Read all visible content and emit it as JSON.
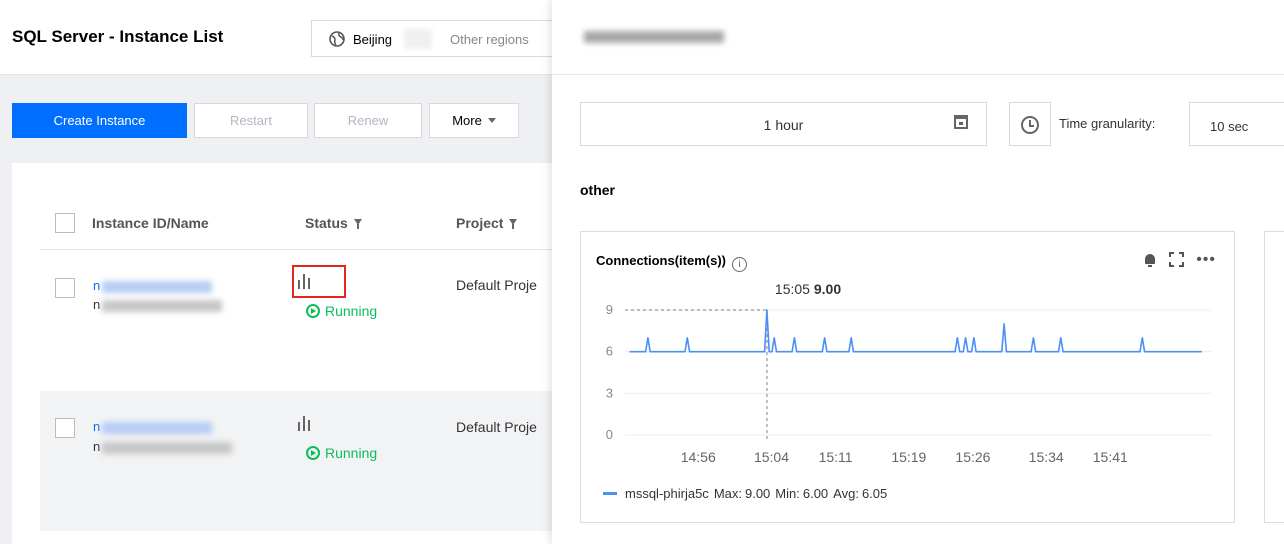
{
  "page": {
    "title": "SQL Server - Instance List",
    "region": {
      "current": "Beijing",
      "other": "Other regions"
    }
  },
  "toolbar": {
    "create_label": "Create Instance",
    "restart_label": "Restart",
    "renew_label": "Renew",
    "more_label": "More"
  },
  "table": {
    "columns": [
      "Instance ID/Name",
      "Status",
      "Project"
    ],
    "rows": [
      {
        "id_prefix": "n",
        "name_prefix": "n",
        "status": "Running",
        "project": "Default Proje"
      },
      {
        "id_prefix": "n",
        "name_prefix": "n",
        "status": "Running",
        "project": "Default Proje"
      }
    ]
  },
  "drawer": {
    "time_range": "1 hour",
    "granularity_label": "Time granularity:",
    "granularity_value": "10 sec",
    "section_title": "other"
  },
  "colors": {
    "primary": "#006eff",
    "running": "#0abf5b",
    "series": "#4d8ef7",
    "highlight_border": "#e1261c"
  },
  "chart_data": {
    "type": "line",
    "title": "Connections(item(s))",
    "xlabel": "",
    "ylabel": "",
    "y_ticks": [
      0,
      3,
      6,
      9
    ],
    "ylim": [
      0,
      9
    ],
    "x_ticks": [
      "14:56",
      "15:04",
      "15:11",
      "15:19",
      "15:26",
      "15:34",
      "15:41"
    ],
    "x_tick_minutes": [
      56,
      64,
      71,
      79,
      86,
      94,
      101
    ],
    "x_range_minutes": [
      48,
      112
    ],
    "grid": true,
    "baseline": 6,
    "spikes": [
      {
        "t": 50.5,
        "v": 7
      },
      {
        "t": 54.8,
        "v": 7
      },
      {
        "t": 63.5,
        "v": 9
      },
      {
        "t": 64.3,
        "v": 7
      },
      {
        "t": 66.5,
        "v": 7
      },
      {
        "t": 69.8,
        "v": 7
      },
      {
        "t": 72.7,
        "v": 7
      },
      {
        "t": 84.3,
        "v": 7
      },
      {
        "t": 85.2,
        "v": 7
      },
      {
        "t": 86.1,
        "v": 7
      },
      {
        "t": 89.4,
        "v": 8
      },
      {
        "t": 92.6,
        "v": 7
      },
      {
        "t": 95.6,
        "v": 7
      },
      {
        "t": 104.5,
        "v": 7
      }
    ],
    "tooltip": {
      "time": "15:05",
      "value": "9.00"
    },
    "series": [
      {
        "name": "mssql-phirja5c",
        "max": "9.00",
        "min": "6.00",
        "avg": "6.05"
      }
    ],
    "legend_text": {
      "max_label": "Max:",
      "min_label": "Min:",
      "avg_label": "Avg:"
    }
  }
}
